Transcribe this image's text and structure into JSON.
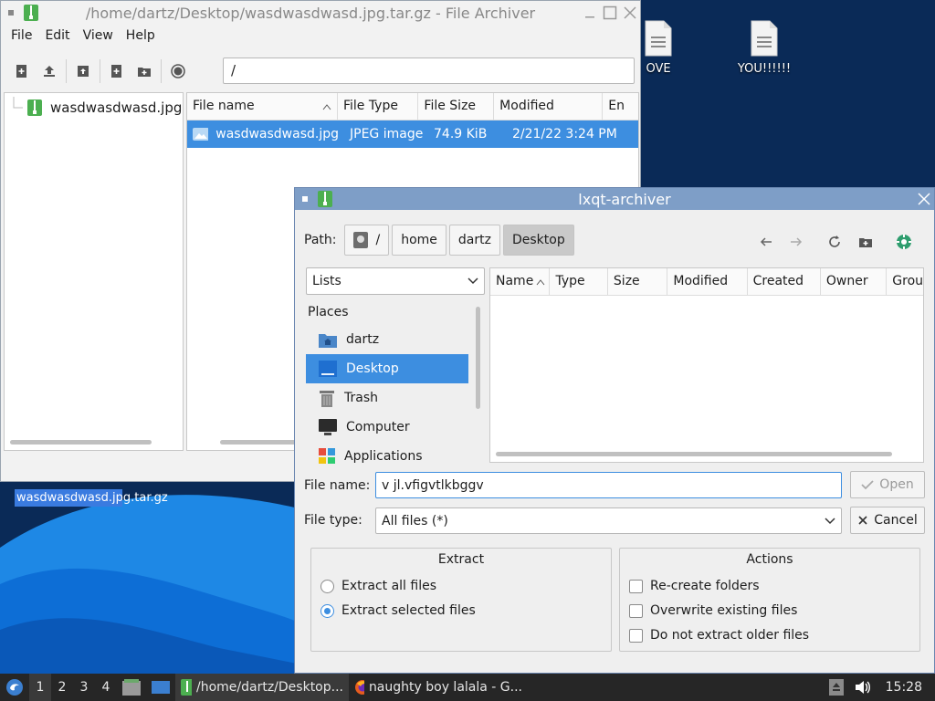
{
  "desktop": {
    "icons": [
      {
        "label": "OVE",
        "icon": "text-document-icon"
      },
      {
        "label": "YOU!!!!!!",
        "icon": "text-document-icon"
      }
    ],
    "selected_file_label": "wasdwasdwasd.jpg.tar.gz"
  },
  "file_archiver": {
    "title": "/home/dartz/Desktop/wasdwasdwasd.jpg.tar.gz - File Archiver",
    "menu": [
      "File",
      "Edit",
      "View",
      "Help"
    ],
    "toolbar": [
      "add-file-icon",
      "extract-icon",
      "archive-icon",
      "new-archive-icon",
      "add-folder-icon",
      "stop-icon"
    ],
    "location": "/",
    "tree_item": "wasdwasdwasd.jpg.tar.gz",
    "columns": [
      "File name",
      "File Type",
      "File Size",
      "Modified",
      "En"
    ],
    "rows": [
      {
        "name": "wasdwasdwasd.jpg",
        "type": "JPEG image",
        "size": "74.9 KiB",
        "modified": "2/21/22 3:24 PM"
      }
    ]
  },
  "dialog": {
    "title": "lxqt-archiver",
    "path_label": "Path:",
    "crumbs": [
      "/",
      "home",
      "dartz",
      "Desktop"
    ],
    "view_combo": "Lists",
    "places_header": "Places",
    "places": [
      {
        "label": "dartz",
        "icon": "home-folder-icon"
      },
      {
        "label": "Desktop",
        "icon": "desktop-icon",
        "selected": true
      },
      {
        "label": "Trash",
        "icon": "trash-icon"
      },
      {
        "label": "Computer",
        "icon": "computer-icon"
      },
      {
        "label": "Applications",
        "icon": "applications-icon"
      }
    ],
    "columns": [
      "Name",
      "Type",
      "Size",
      "Modified",
      "Created",
      "Owner",
      "Grou"
    ],
    "file_name_label": "File name:",
    "file_name_value": "v jl.vfigvtlkbggv",
    "file_type_label": "File type:",
    "file_type_value": "All files (*)",
    "open_label": "Open",
    "cancel_label": "Cancel",
    "extract": {
      "title": "Extract",
      "options": [
        {
          "label": "Extract all files",
          "checked": false
        },
        {
          "label": "Extract selected files",
          "checked": true
        }
      ]
    },
    "actions": {
      "title": "Actions",
      "options": [
        {
          "label": "Re-create folders",
          "checked": false
        },
        {
          "label": "Overwrite existing files",
          "checked": false
        },
        {
          "label": "Do not extract older files",
          "checked": false
        }
      ]
    }
  },
  "taskbar": {
    "workspaces": [
      "1",
      "2",
      "3",
      "4"
    ],
    "tasks": [
      {
        "label": "/home/dartz/Desktop...",
        "icon": "archive-icon"
      },
      {
        "label": "naughty boy lalala - G...",
        "icon": "firefox-icon"
      }
    ],
    "clock": "15:28"
  },
  "colors": {
    "accent": "#3d8ee0",
    "dialog_titlebar": "#7e9ec7",
    "desktop": "#0a2a57",
    "archive_green": "#4caf50"
  }
}
